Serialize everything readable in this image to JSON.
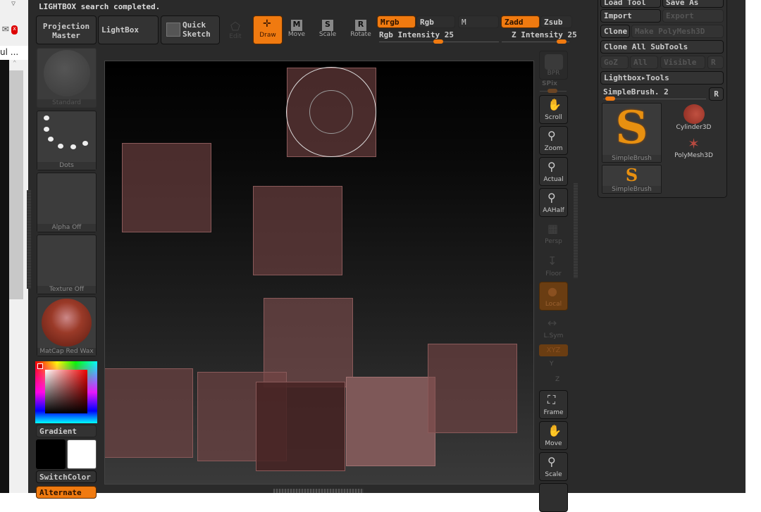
{
  "browser": {
    "tab_text": "ul ...",
    "mail_icon": "mail-error-icon"
  },
  "status": "LIGHTBOX search completed.",
  "top_buttons": {
    "projection_master": "Projection Master",
    "lightbox": "LightBox",
    "quick_sketch": "Quick Sketch"
  },
  "tools": [
    {
      "label": "Edit",
      "active": false,
      "disabled": true
    },
    {
      "label": "Draw",
      "active": true
    },
    {
      "label": "Move",
      "badge": "M"
    },
    {
      "label": "Scale",
      "badge": "S"
    },
    {
      "label": "Rotate",
      "badge": "R"
    }
  ],
  "modes": {
    "mrgb": "Mrgb",
    "rgb": "Rgb",
    "m": "M",
    "zadd": "Zadd",
    "zsub": "Zsub"
  },
  "rgb_intensity": {
    "label": "Rgb Intensity 25",
    "value": 25
  },
  "z_intensity": {
    "label": "Z Intensity 25",
    "value": 25
  },
  "left_panel": {
    "brush": "Standard",
    "stroke": "Dots",
    "alpha": "Alpha Off",
    "texture": "Texture Off",
    "material": "MatCap Red Wax",
    "gradient": "Gradient",
    "switch_color": "SwitchColor",
    "alternate": "Alternate",
    "main_color": "#cc0000",
    "secondary_color": "#ffffff"
  },
  "right_shelf": [
    "BPR",
    "SPix",
    "Scroll",
    "Zoom",
    "Actual",
    "AAHalf",
    "Persp",
    "Floor",
    "Local",
    "L.Sym",
    "XYZ",
    "Y",
    "Z",
    "Frame",
    "Move",
    "Scale"
  ],
  "tool_palette": {
    "load_tool": "Load Tool",
    "save_as": "Save As",
    "import": "Import",
    "export": "Export",
    "clone": "Clone",
    "make_polymesh": "Make PolyMesh3D",
    "clone_all": "Clone All SubTools",
    "goz": "GoZ",
    "all": "All",
    "visible": "Visible",
    "r": "R",
    "lightbox_tools": "Lightbox▸Tools",
    "current_tool": "SimpleBrush. 2",
    "tools": [
      "SimpleBrush",
      "Cylinder3D",
      "PolyMesh3D",
      "SimpleBrush"
    ]
  },
  "colors": {
    "accent": "#f07a10",
    "background": "#2a2a2a"
  }
}
